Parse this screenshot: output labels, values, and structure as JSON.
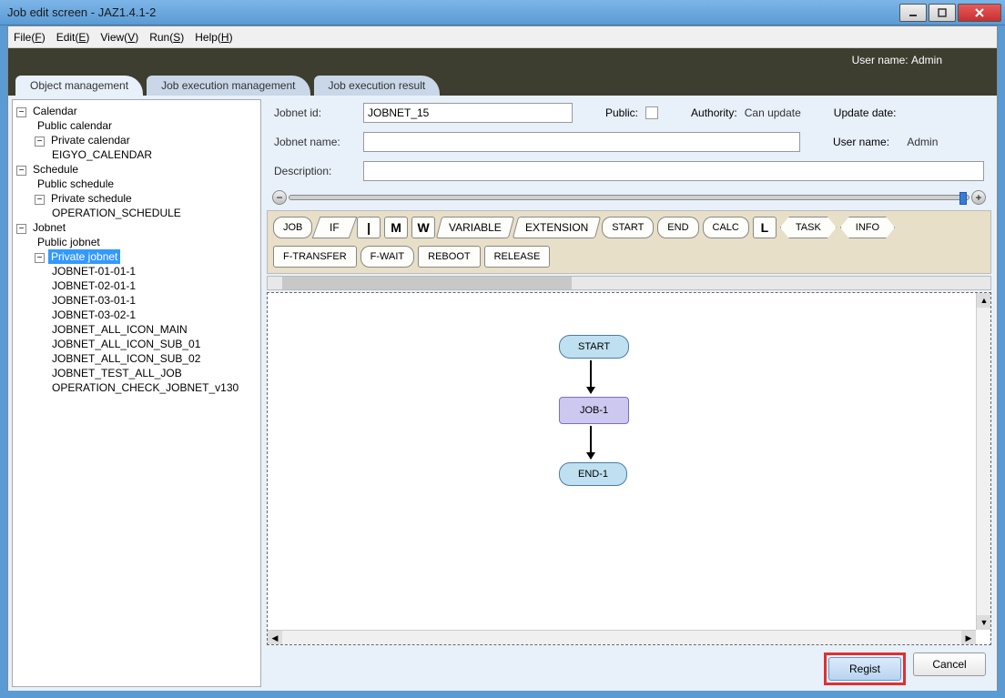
{
  "window": {
    "title": "Job edit screen - JAZ1.4.1-2"
  },
  "menu": {
    "file": "File(F)",
    "edit": "Edit(E)",
    "view": "View(V)",
    "run": "Run(S)",
    "help": "Help(H)"
  },
  "infobar": {
    "user_label": "User name:",
    "user_value": "Admin"
  },
  "tabs": {
    "t1": "Object management",
    "t2": "Job execution management",
    "t3": "Job execution result"
  },
  "tree": {
    "calendar": "Calendar",
    "public_calendar": "Public calendar",
    "private_calendar": "Private calendar",
    "eigyo": "EIGYO_CALENDAR",
    "schedule": "Schedule",
    "public_schedule": "Public schedule",
    "private_schedule": "Private schedule",
    "op_schedule": "OPERATION_SCHEDULE",
    "jobnet": "Jobnet",
    "public_jobnet": "Public jobnet",
    "private_jobnet": "Private jobnet",
    "items": [
      "JOBNET-01-01-1",
      "JOBNET-02-01-1",
      "JOBNET-03-01-1",
      "JOBNET-03-02-1",
      "JOBNET_ALL_ICON_MAIN",
      "JOBNET_ALL_ICON_SUB_01",
      "JOBNET_ALL_ICON_SUB_02",
      "JOBNET_TEST_ALL_JOB",
      "OPERATION_CHECK_JOBNET_v130"
    ]
  },
  "form": {
    "jobnet_id_label": "Jobnet id:",
    "jobnet_id_value": "JOBNET_15",
    "public_label": "Public:",
    "authority_label": "Authority:",
    "authority_value": "Can update",
    "update_date_label": "Update date:",
    "jobnet_name_label": "Jobnet name:",
    "user_name_label": "User name:",
    "user_name_value": "Admin",
    "description_label": "Description:"
  },
  "tools": {
    "job": "JOB",
    "if": "IF",
    "var": "VARIABLE",
    "ext": "EXTENSION",
    "start": "START",
    "end": "END",
    "calc": "CALC",
    "task": "TASK",
    "info": "INFO",
    "ftransfer": "F-TRANSFER",
    "fwait": "F-WAIT",
    "reboot": "REBOOT",
    "release": "RELEASE",
    "m": "M",
    "w": "W",
    "l": "L",
    "pipe": "|"
  },
  "flow": {
    "start": "START",
    "job1": "JOB-1",
    "end1": "END-1"
  },
  "buttons": {
    "regist": "Regist",
    "cancel": "Cancel"
  }
}
